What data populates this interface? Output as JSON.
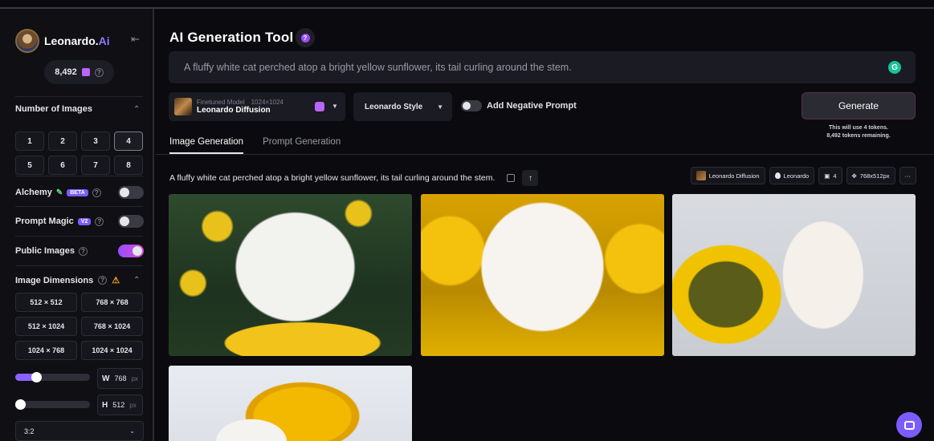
{
  "brand": {
    "name": "Leonardo.",
    "name_ai": "Ai"
  },
  "sidebar": {
    "token_count": "8,492",
    "num_images": {
      "title": "Number of Images",
      "options": [
        "1",
        "2",
        "3",
        "4",
        "5",
        "6",
        "7",
        "8"
      ],
      "selected": "4"
    },
    "alchemy": {
      "label": "Alchemy",
      "badge": "BETA",
      "on": false
    },
    "prompt_magic": {
      "label": "Prompt Magic",
      "badge": "V2",
      "on": false
    },
    "public_images": {
      "label": "Public Images",
      "on": true
    },
    "dimensions": {
      "title": "Image Dimensions",
      "options": [
        "512 × 512",
        "768 × 768",
        "512 × 1024",
        "768 × 1024",
        "1024 × 768",
        "1024 × 1024"
      ],
      "width": {
        "label": "W",
        "value": "768",
        "unit": "px",
        "fraction": 0.25
      },
      "height": {
        "label": "H",
        "value": "512",
        "unit": "px",
        "fraction": 0.0
      },
      "aspect_ratio": "3:2"
    }
  },
  "header": {
    "title": "AI Generation Tool",
    "help_icon": "?"
  },
  "prompt": {
    "value": "A fluffy white cat perched atop a bright yellow sunflower, its tail curling around the stem.",
    "grammarly_icon": "G"
  },
  "model": {
    "caption": "Finetuned Model",
    "size": "1024×1024",
    "name": "Leonardo Diffusion"
  },
  "style": {
    "value": "Leonardo Style"
  },
  "negative_prompt": {
    "label": "Add Negative Prompt",
    "on": false
  },
  "generate": {
    "label": "Generate",
    "note_line1": "This will use 4 tokens.",
    "note_line2": "8,492 tokens remaining."
  },
  "tabs": [
    {
      "label": "Image Generation",
      "active": true
    },
    {
      "label": "Prompt Generation",
      "active": false
    }
  ],
  "result": {
    "prompt": "A fluffy white cat perched atop a bright yellow sunflower, its tail curling around the stem.",
    "chips": {
      "model": "Leonardo Diffusion",
      "style": "Leonardo",
      "count": "4",
      "size": "768x512px",
      "more": "···"
    }
  },
  "colors": {
    "accent": "#8a62ff",
    "toggle_on": "#b94de8",
    "generate_border": "#5a2f4a"
  }
}
